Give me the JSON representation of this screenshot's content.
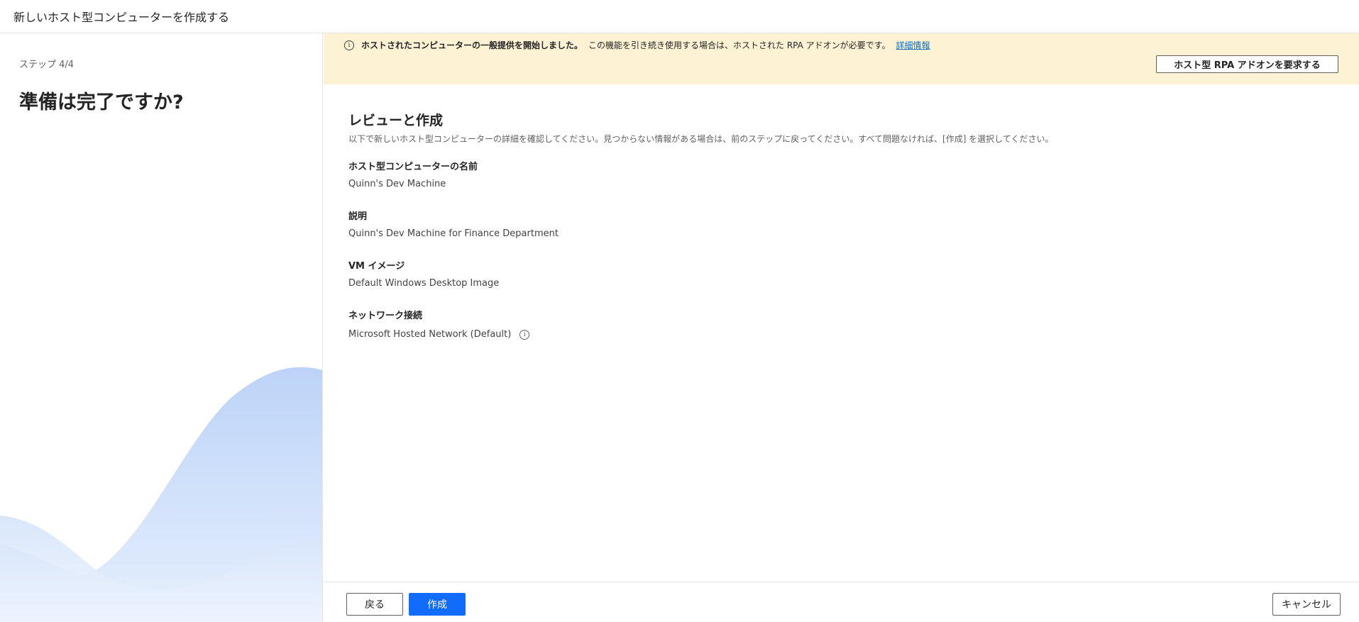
{
  "window": {
    "title": "新しいホスト型コンピューターを作成する"
  },
  "left_pane": {
    "step": "ステップ 4/4",
    "heading": "準備は完了ですか?"
  },
  "banner": {
    "icon": "info-icon",
    "bold_text": "ホストされたコンピューターの一般提供を開始しました。",
    "text": "この機能を引き続き使用する場合は、ホストされた RPA アドオンが必要です。",
    "link": "詳細情報",
    "button_label": "ホスト型 RPA アドオンを要求する",
    "background_color": "#fdf3d4"
  },
  "review": {
    "title": "レビューと作成",
    "description": "以下で新しいホスト型コンピューターの詳細を確認してください。見つからない情報がある場合は、前のステップに戻ってください。すべて問題なければ、[作成] を選択してください。",
    "fields": [
      {
        "label": "ホスト型コンピューターの名前",
        "value": "Quinn's Dev Machine"
      },
      {
        "label": "説明",
        "value": "Quinn's Dev Machine for Finance Department"
      },
      {
        "label": "VM イメージ",
        "value": "Default Windows Desktop Image"
      },
      {
        "label": "ネットワーク接続",
        "value": "Microsoft Hosted Network (Default)",
        "icon": "info-icon"
      }
    ]
  },
  "footer": {
    "back_label": "戻る",
    "create_label": "作成",
    "cancel_label": "キャンセル",
    "primary_color": "#0f6cfd"
  }
}
